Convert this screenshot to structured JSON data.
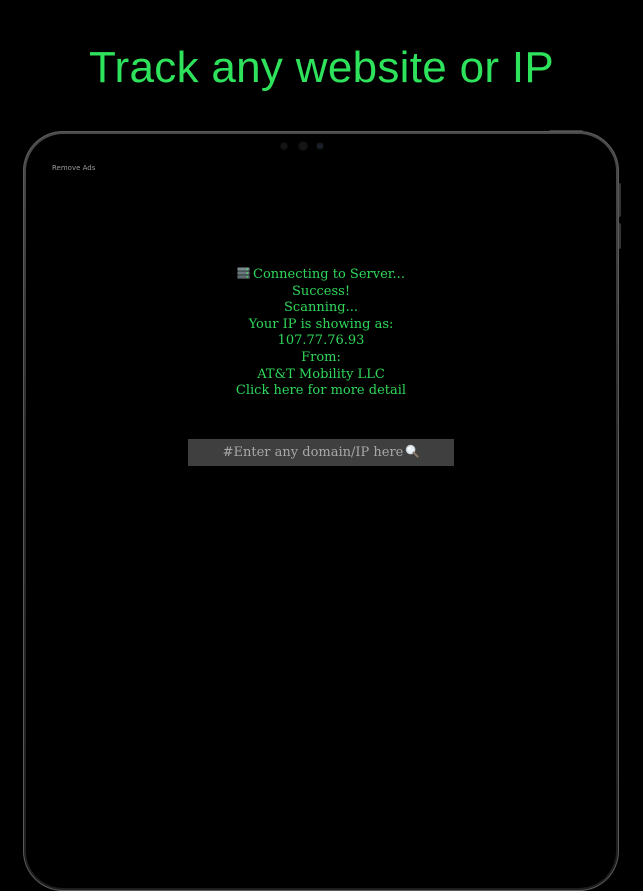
{
  "headline": "Track any website or IP",
  "app": {
    "remove_ads_label": "Remove Ads",
    "status_lines": {
      "connecting": "Connecting to Server...",
      "success": "Success!",
      "scanning": "Scanning...",
      "ip_label": "Your IP is showing as:",
      "ip_value": "107.77.76.93",
      "from_label": "From:",
      "isp_value": "AT&T Mobility LLC",
      "detail_link": "Click here for more detail"
    },
    "search": {
      "placeholder": "#Enter any domain/IP here"
    }
  },
  "colors": {
    "background": "#000000",
    "accent_green": "#2ee35b",
    "field_bg": "#3f3f3f",
    "placeholder_text": "#a8a8a8"
  },
  "icons": {
    "status": "server-icon",
    "search": "magnifier-icon"
  }
}
